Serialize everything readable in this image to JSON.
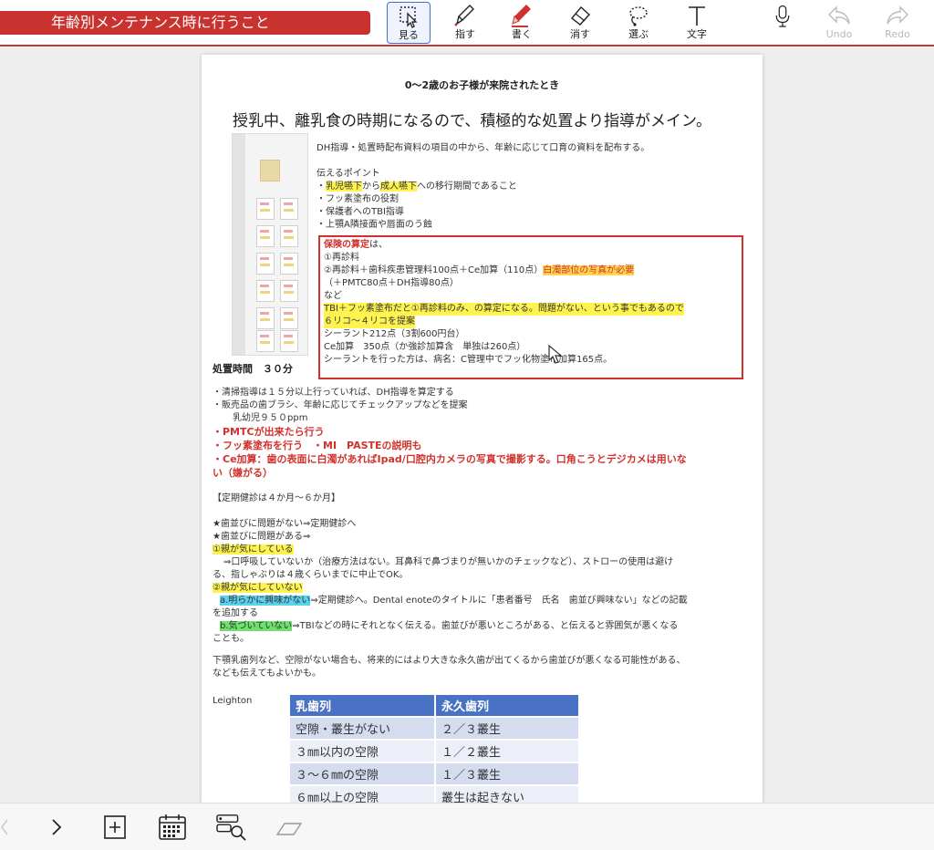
{
  "app": {
    "doc_title": "年齢別メンテナンス時に行うこと"
  },
  "toolbar": {
    "view": "見る",
    "point": "指す",
    "write": "書く",
    "erase": "消す",
    "select": "選ぶ",
    "text": "文字",
    "undo": "Undo",
    "redo": "Redo"
  },
  "doc": {
    "header": "0～2歳のお子様が来院されたとき",
    "headline": "授乳中、離乳食の時期になるので、積極的な処置より指導がメイン。",
    "intro": "DH指導・処置時配布資料の項目の中から、年齢に応じて口育の資料を配布する。",
    "points_title": "伝えるポイント",
    "p1_a": "・",
    "p1_hl1": "乳児嚥下",
    "p1_b": "から",
    "p1_hl2": "成人嚥下",
    "p1_c": "への移行期間であること",
    "p2": "・フッ素塗布の役割",
    "p3": "・保護者へのTBI指導",
    "p4": "・上顎A隣接面や唇面のう蝕",
    "box_title_red": "保険の算定",
    "box_title_rest": "は、",
    "box_l1": "①再診料",
    "box_l2": "②再診料＋歯科疾患管理料100点＋Ce加算（110点）",
    "box_l2_hl": "白濁部位の写真が必要",
    "box_l3": "（＋PMTC80点＋DH指導80点）",
    "box_l4": "など",
    "box_l5": "TBI＋フッ素塗布だと①再診料のみ、の算定になる。問題がない、という事でもあるので",
    "box_l6": "６リコ～４リコを提案",
    "box_l7": "シーラント212点（3割600円台）",
    "box_l8": "Ce加算　350点（か強診加算含　単独は260点）",
    "box_l9": "シーラントを行った方は、病名：C管理中でフッ化物塗布加算165点。",
    "time_label": "処置時間　３０分",
    "t1": "・清掃指導は１５分以上行っていれば、DH指導を算定する",
    "t2": "・販売品の歯ブラシ、年齢に応じてチェックアップなどを提案",
    "t3": "乳幼児９５０ppm",
    "r1": "・PMTCが出来たら行う",
    "r2": "・フッ素塗布を行う　・MI　PASTEの説明も",
    "r3": "・Ce加算：歯の表面に白濁があればIpad/口腔内カメラの写真で撮影する。口角こうとデジカメは用いな",
    "r4": "い（嫌がる）",
    "checkup": "【定期健診は４か月～６か月】",
    "s1": "★歯並びに問題がない⇒定期健診へ",
    "s2": "★歯並びに問題がある⇒",
    "s3_hl": "①親が気にしている",
    "s4": "⇒口呼吸していないか（治療方法はない。耳鼻科で鼻づまりが無いかのチェックなど）、ストローの使用は避け",
    "s5": "る、指しゃぶりは４歳くらいまでに中止でOK。",
    "s6_hl": "②親が気にしていない",
    "s7_hl": "a.明らかに興味がない",
    "s7": "⇒定期健診へ。Dental enoteのタイトルに「患者番号　氏名　歯並び興味ない」などの記載",
    "s8": "を追加する",
    "s9_hl": "b.気づいていない",
    "s9": "⇒TBIなどの時にそれとなく伝える。歯並びが悪いところがある、と伝えると雰囲気が悪くなる",
    "s10": "ことも。",
    "u1": "下顎乳歯列など、空隙がない場合も、将来的にはより大きな永久歯が出てくるから歯並びが悪くなる可能性がある、",
    "u2": "なども伝えてもよいかも。",
    "leighton": "Leighton",
    "table": {
      "headers": [
        "乳歯列",
        "永久歯列"
      ],
      "rows": [
        [
          "空隙・叢生がない",
          "２／３叢生"
        ],
        [
          "３㎜以内の空隙",
          "１／２叢生"
        ],
        [
          "３～６㎜の空隙",
          "１／３叢生"
        ],
        [
          "６㎜以上の空隙",
          "叢生は起きない"
        ]
      ]
    }
  }
}
